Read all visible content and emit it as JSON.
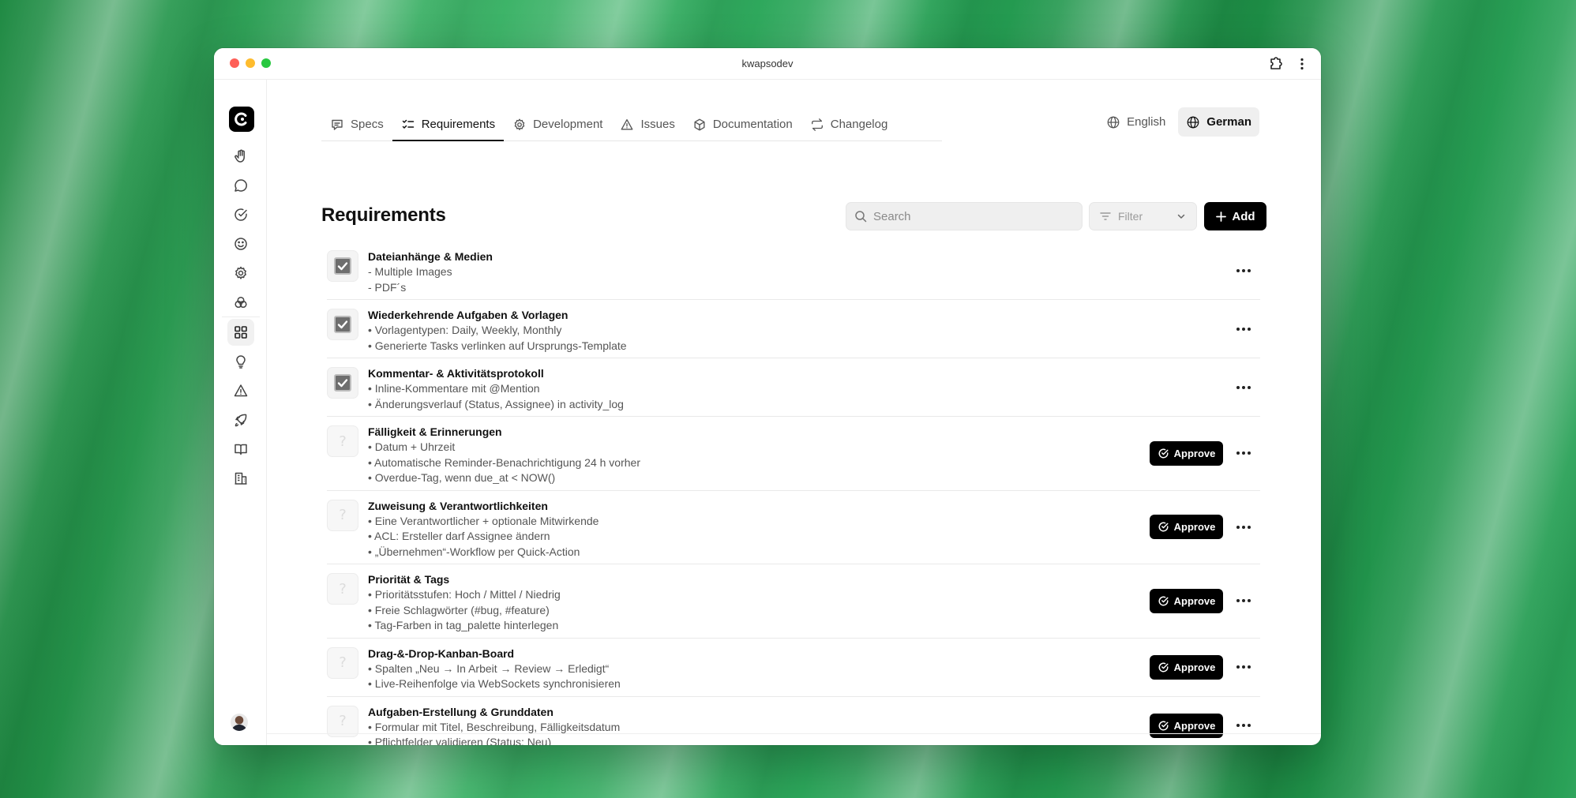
{
  "window": {
    "title": "kwapsodev"
  },
  "nav_tabs": [
    {
      "label": "Specs",
      "icon": "chat-bubble-icon",
      "active": false
    },
    {
      "label": "Requirements",
      "icon": "checklist-icon",
      "active": true
    },
    {
      "label": "Development",
      "icon": "gear-icon",
      "active": false
    },
    {
      "label": "Issues",
      "icon": "warning-icon",
      "active": false
    },
    {
      "label": "Documentation",
      "icon": "hexagon-icon",
      "active": false
    },
    {
      "label": "Changelog",
      "icon": "arrows-icon",
      "active": false
    }
  ],
  "languages": [
    {
      "label": "English",
      "active": false
    },
    {
      "label": "German",
      "active": true
    }
  ],
  "page": {
    "title": "Requirements"
  },
  "toolbar": {
    "search_placeholder": "Search",
    "filter_label": "Filter",
    "add_label": "Add"
  },
  "approve_label": "Approve",
  "requirements": [
    {
      "title": "Dateianhänge & Medien",
      "done": true,
      "lines": [
        "- Multiple Images",
        "- PDF´s"
      ]
    },
    {
      "title": "Wiederkehrende Aufgaben & Vorlagen",
      "done": true,
      "lines": [
        "• Vorlagentypen: Daily, Weekly, Monthly",
        "• Generierte Tasks verlinken auf Ursprungs-Template"
      ]
    },
    {
      "title": "Kommentar- & Aktivitätsprotokoll",
      "done": true,
      "lines": [
        "• Inline-Kommentare mit @Mention",
        "• Änderungsverlauf (Status, Assignee) in activity_log"
      ]
    },
    {
      "title": "Fälligkeit & Erinnerungen",
      "done": false,
      "lines": [
        "• Datum + Uhrzeit",
        "• Automatische Reminder-Benachrichtigung 24 h vorher",
        "• Overdue-Tag, wenn due_at < NOW()"
      ]
    },
    {
      "title": "Zuweisung & Verantwortlichkeiten",
      "done": false,
      "lines": [
        "• Eine Verantwortlicher + optionale Mitwirkende",
        "• ACL: Ersteller darf Assignee ändern",
        "• „Übernehmen“-Workflow per Quick-Action"
      ]
    },
    {
      "title": "Priorität & Tags",
      "done": false,
      "lines": [
        "• Prioritätsstufen: Hoch / Mittel / Niedrig",
        "• Freie Schlagwörter (#bug, #feature)",
        "• Tag-Farben in tag_palette hinterlegen"
      ]
    },
    {
      "title": "Drag-&-Drop-Kanban-Board",
      "done": false,
      "lines": [
        "• Spalten „Neu → In Arbeit → Review → Erledigt“",
        "• Live-Reihenfolge via WebSockets synchronisieren"
      ]
    },
    {
      "title": "Aufgaben-Erstellung & Grunddaten",
      "done": false,
      "lines": [
        "• Formular mit Titel, Beschreibung, Fälligkeitsdatum",
        "• Pflichtfelder validieren (Status: Neu)"
      ]
    }
  ],
  "sidebar_icons": [
    "hand-icon",
    "chat-icon",
    "check-circle-icon",
    "smiley-icon",
    "settings-icon",
    "circles-icon",
    "grid-icon",
    "lightbulb-icon",
    "warning-icon",
    "rocket-icon",
    "book-icon",
    "building-icon"
  ],
  "colors": {
    "accent": "#000000",
    "wallpaper": "#2e9e55"
  }
}
